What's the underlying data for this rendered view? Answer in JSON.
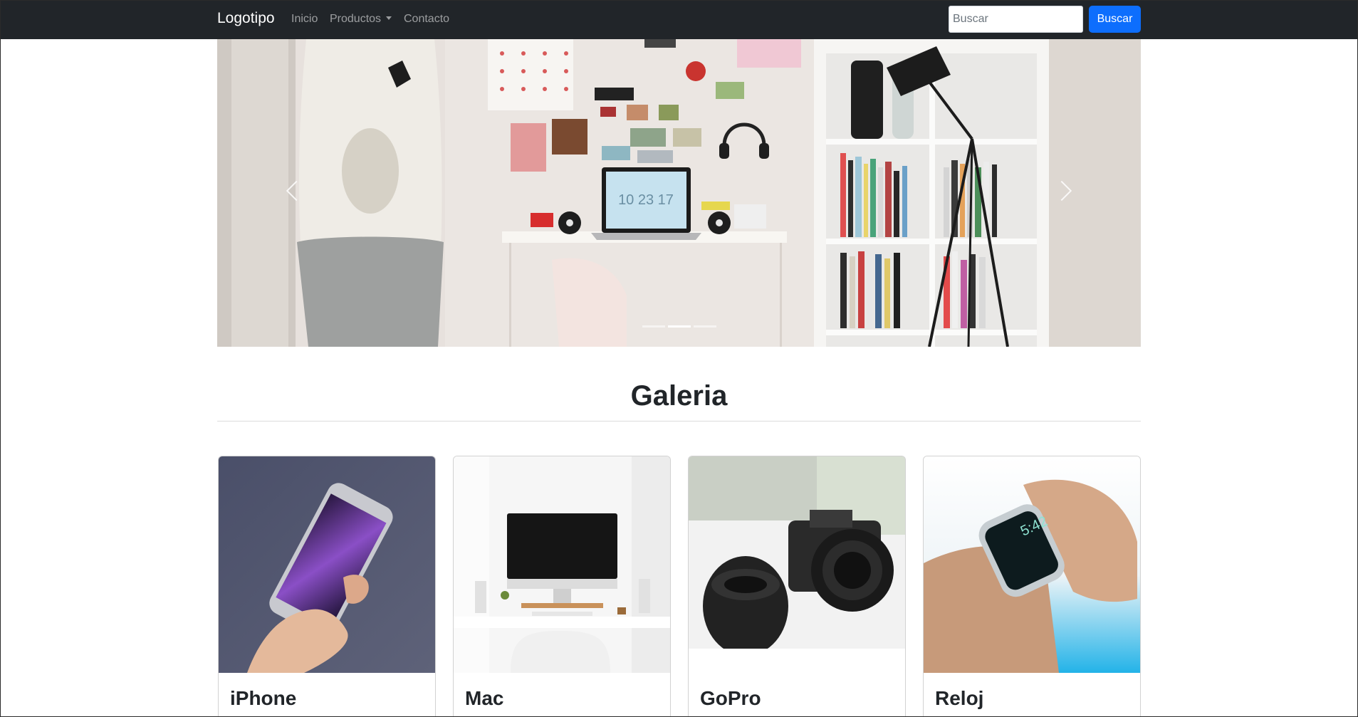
{
  "navbar": {
    "brand": "Logotipo",
    "links": [
      "Inicio",
      "Productos",
      "Contacto"
    ],
    "search_placeholder": "Buscar",
    "search_button": "Buscar"
  },
  "carousel": {
    "indicator_count": 3,
    "active_indicator": 1,
    "laptop_clock": "10 23 17"
  },
  "gallery": {
    "title": "Galeria",
    "cards": [
      {
        "title": "iPhone"
      },
      {
        "title": "Mac"
      },
      {
        "title": "GoPro"
      },
      {
        "title": "Reloj"
      }
    ]
  },
  "colors": {
    "navbar_bg": "#212529",
    "primary_button": "#0d6efd"
  }
}
